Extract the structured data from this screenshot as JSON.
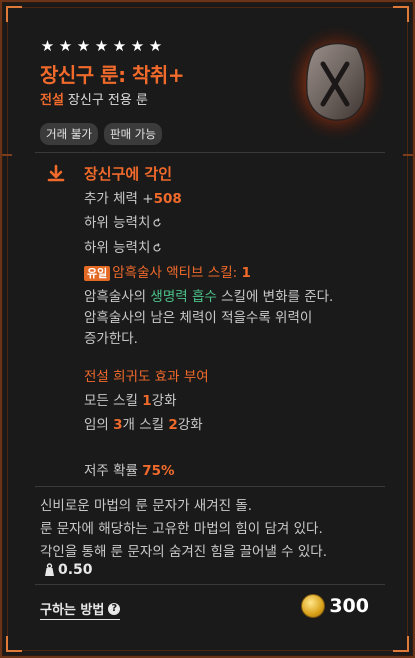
{
  "item": {
    "stars": 7,
    "name": "장신구 룬: 착취+",
    "rarity": "전설",
    "category": "장신구 전용 룬",
    "tags": [
      "거래 불가",
      "판매 가능"
    ]
  },
  "engrave": {
    "title": "장신구에 각인",
    "stat_label": "추가 체력 +",
    "stat_value": "508",
    "sub1": "하위 능력치",
    "sub2": "하위 능력치",
    "badge": "유일",
    "skill_label": "암흑술사 액티브 스킬: ",
    "skill_value": "1",
    "effect_pre": "암흑술사의 ",
    "effect_skill": "생명력 흡수",
    "effect_post": " 스킬에 변화를 준다.",
    "effect_line2": "암흑술사의 남은 체력이 적을수록 위력이",
    "effect_line3": "증가한다.",
    "legend_title": "전설 희귀도 효과 부여",
    "all_skill_pre": "모든 스킬 ",
    "all_skill_val": "1",
    "all_skill_post": "강화",
    "rand_pre": "임의 ",
    "rand_count": "3",
    "rand_mid": "개 스킬 ",
    "rand_val": "2",
    "rand_post": "강화",
    "curse_label": "저주 확률 ",
    "curse_value": "75%"
  },
  "description": [
    "신비로운 마법의 룬 문자가 새겨진 돌.",
    "룬 문자에 해당하는 고유한 마법의 힘이 담겨 있다.",
    "각인을 통해 룬 문자의 숨겨진 힘을 끌어낼 수 있다."
  ],
  "weight": "0.50",
  "footer": {
    "how_to_get": "구하는 방법",
    "price": "300"
  },
  "colors": {
    "accent": "#f06a2b",
    "green": "#4cc28a",
    "frame": "#6a3418"
  }
}
